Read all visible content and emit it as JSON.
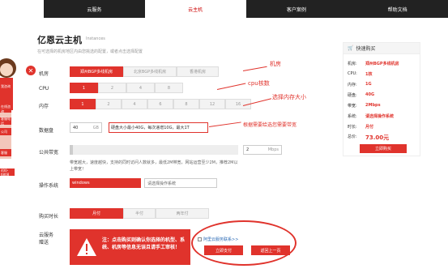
{
  "nav": {
    "tabs": [
      "云服务",
      "云主机",
      "客户案例",
      "帮助文档"
    ],
    "active": 1
  },
  "page": {
    "title": "亿恩云主机",
    "subtitle": "Instances",
    "desc": "在可选择的机房地区内由您挑选的配置，或者点击选择配置"
  },
  "labels": {
    "room": "机房",
    "cpu": "CPU",
    "mem": "内存",
    "disk": "数据盘",
    "bw": "公共带宽",
    "os": "操作系统",
    "period": "购买时长",
    "support": "云服务\n赠送"
  },
  "rooms": [
    "郑州BGP多线机房",
    "北京BGP多线机房",
    "香港机房"
  ],
  "cpus": [
    "1",
    "2",
    "4",
    "8"
  ],
  "mems": [
    "1",
    "2",
    "4",
    "6",
    "8",
    "12",
    "16"
  ],
  "disk": {
    "value": "40",
    "unit": "GB",
    "hint": "硬盘大小最小40G，每次递增10G，最大1T"
  },
  "bw": {
    "value": "2",
    "unit": "Mbps",
    "hint": "带宽越大，速度越快，支持的同时访问人数就多，最低2M带宽，网站运营至少2M，推荐2M以上带宽！"
  },
  "os": {
    "value": "windows",
    "placeholder": "请选择操作系统"
  },
  "periods": [
    "月付",
    "半付",
    "两年付"
  ],
  "annotations": {
    "room": "机房",
    "cpu": "cpu核数",
    "mem": "选择内存大小",
    "disk": "根据需要给选您需要带宽"
  },
  "notice": "注：点击购买则确认你选择的机型、系统、机房等信息无误且请手工审核！",
  "cloud_link": "阿里云服务联系>>",
  "btn_pay": "立即支付",
  "btn_back": "返回上一页",
  "panel": {
    "header": "快速购买",
    "rows": [
      {
        "k": "机房:",
        "v": "郑州BGP多线机房"
      },
      {
        "k": "CPU:",
        "v": "1核"
      },
      {
        "k": "内存:",
        "v": "1G"
      },
      {
        "k": "硬盘:",
        "v": "40G"
      },
      {
        "k": "带宽:",
        "v": "2Mbps"
      },
      {
        "k": "系统:",
        "v": "请选择操作系统"
      },
      {
        "k": "时长:",
        "v": "月付"
      },
      {
        "k": "总价:",
        "v": "73.00元"
      }
    ],
    "buy": "立即购买"
  },
  "side": [
    "我咨询",
    "在线咨询",
    "客服电话",
    "公司",
    "客服",
    "400-6808"
  ],
  "colors": {
    "accent": "#e0332c",
    "nav": "#222222"
  }
}
